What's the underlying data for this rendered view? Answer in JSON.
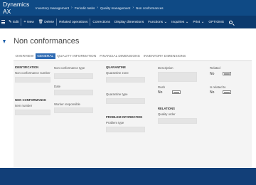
{
  "app": {
    "name": "Dynamics AX",
    "breadcrumbs": [
      "Inventory management",
      "Periodic tasks",
      "Quality management",
      "Non conformances"
    ],
    "separator": "›"
  },
  "actions": {
    "edit": "Edit",
    "new": "New",
    "delete": "Delete",
    "related": "Related operations",
    "corrections": "Corrections",
    "display": "Display dimensions",
    "functions": "Functions",
    "inquiries": "Inquiries",
    "print": "Print",
    "options": "OPTIONS"
  },
  "page": {
    "title": "Non conformances"
  },
  "tabs": [
    "OVERVIEW",
    "GENERAL",
    "QUALITY INFORMATION",
    "FINANCIAL DIMENSIONS",
    "INVENTORY DIMENSIONS"
  ],
  "form": {
    "identification": {
      "header": "IDENTIFICATION",
      "nc_number_label": "Non conformance number"
    },
    "non_conformance": {
      "header": "NON CONFORMANCE",
      "item_number_label": "Item number"
    },
    "col2": {
      "type_label": "Non conformance type",
      "date_label": "Date",
      "worker_label": "Worker responsible"
    },
    "quarantine": {
      "header": "QUARANTINE",
      "zone_label": "Quarantine zone",
      "type_label": "Quarantine type"
    },
    "problem": {
      "header": "PROBLEM INFORMATION",
      "type_label": "Problem type"
    },
    "col4": {
      "description_label": "Description",
      "rush_label": "Rush",
      "rush_value": "No"
    },
    "relations": {
      "header": "RELATIONS",
      "quality_order_label": "Quality order"
    },
    "col5": {
      "related_label": "Related",
      "related_value": "No",
      "related_to_label": "Is related to",
      "related_to_value": "No"
    }
  }
}
